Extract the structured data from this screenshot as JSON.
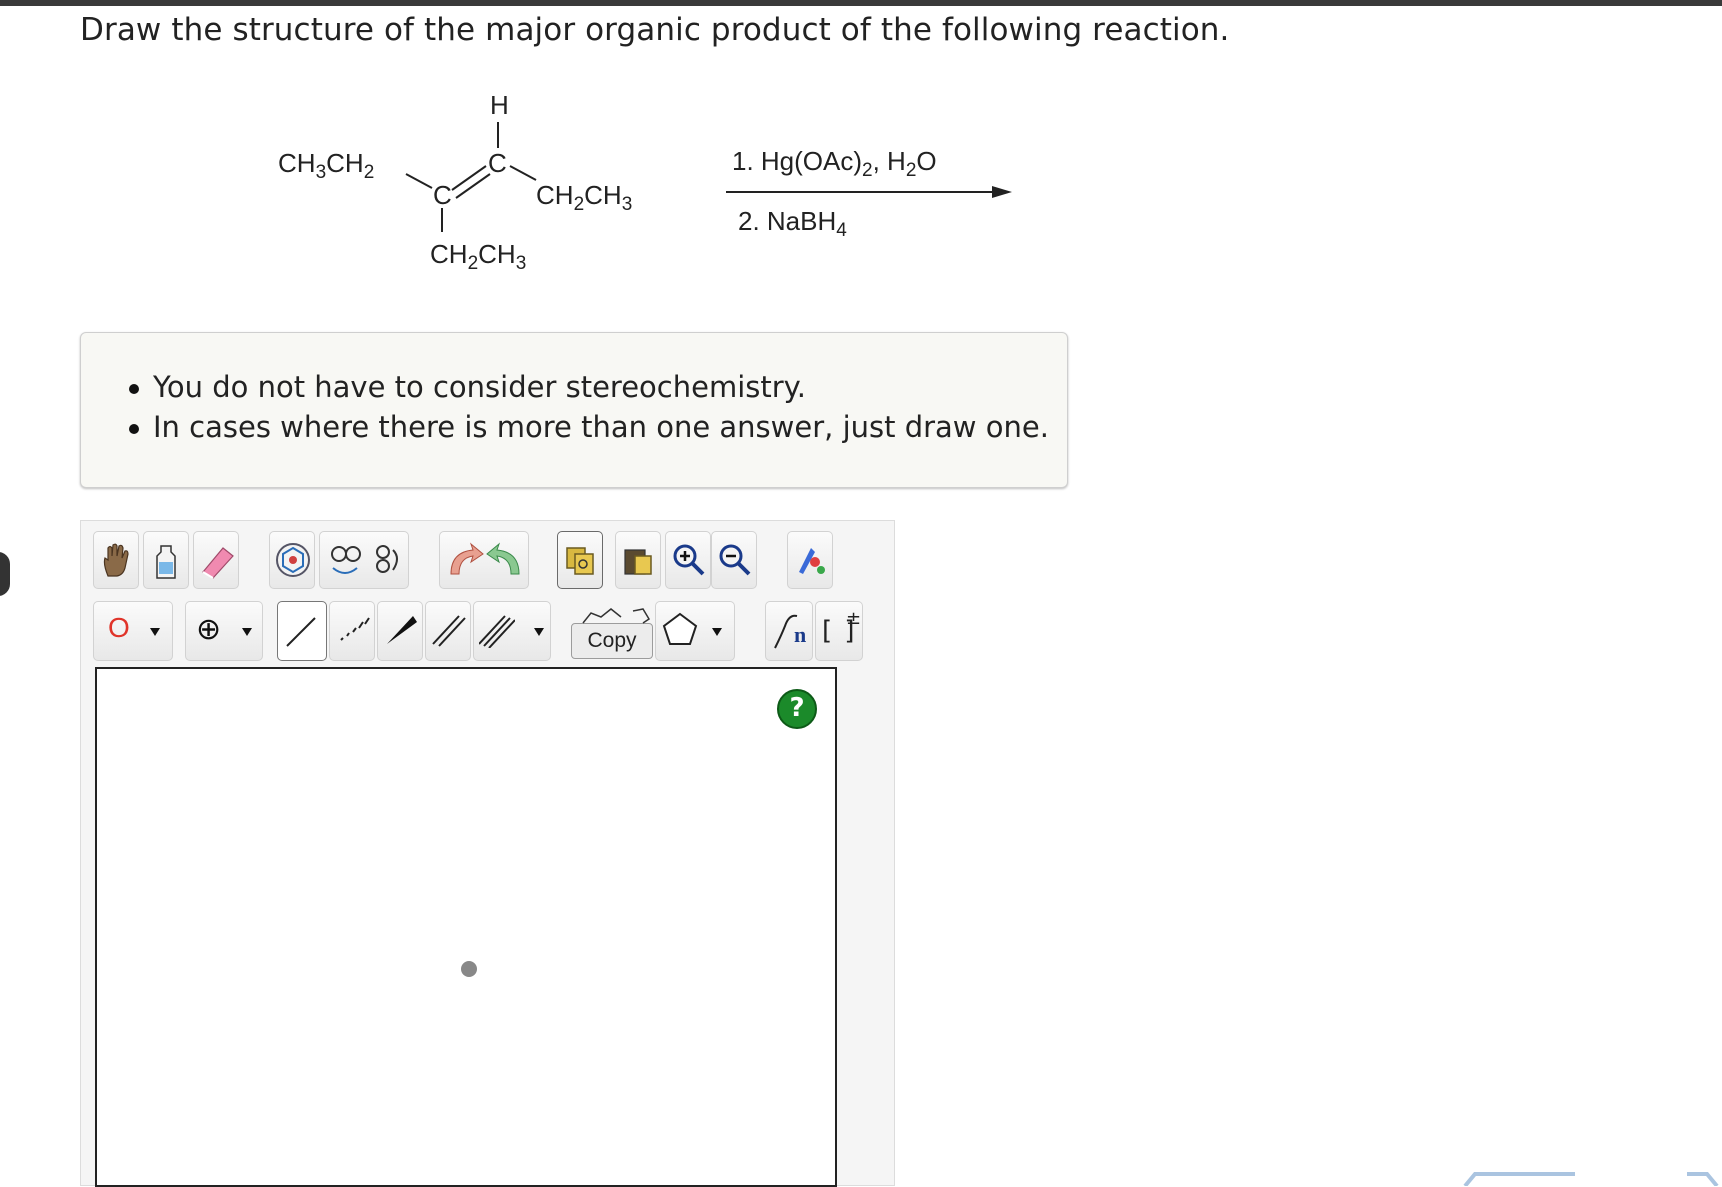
{
  "question": {
    "prompt": "Draw the structure of the major organic product of the following reaction."
  },
  "reaction": {
    "labels": {
      "h": "H",
      "c": "C",
      "ch3": "CH",
      "ch2": "CH",
      "ethyl": "CH",
      "sub2": "2",
      "sub3": "3"
    },
    "reagent1_prefix": "1. Hg(OAc)",
    "reagent1_sub": "2",
    "reagent1_sep": ", H",
    "reagent1_sub2": "2",
    "reagent1_end": "O",
    "reagent2_prefix": "2. NaBH",
    "reagent2_sub": "4"
  },
  "hints": [
    "You do not have to consider stereochemistry.",
    "In cases where there is more than one answer, just draw one."
  ],
  "toolbar": {
    "copy_label": "Copy",
    "atom_label": "O",
    "charge_label": "⊕",
    "bracket_label": "[ ]",
    "bracket_sup": "±",
    "sgroup_label": "n",
    "help_label": "?"
  },
  "colors": {
    "help_green": "#1b8a2a",
    "atom_red": "#e0342a",
    "eraser_pink": "#f08ab0"
  }
}
